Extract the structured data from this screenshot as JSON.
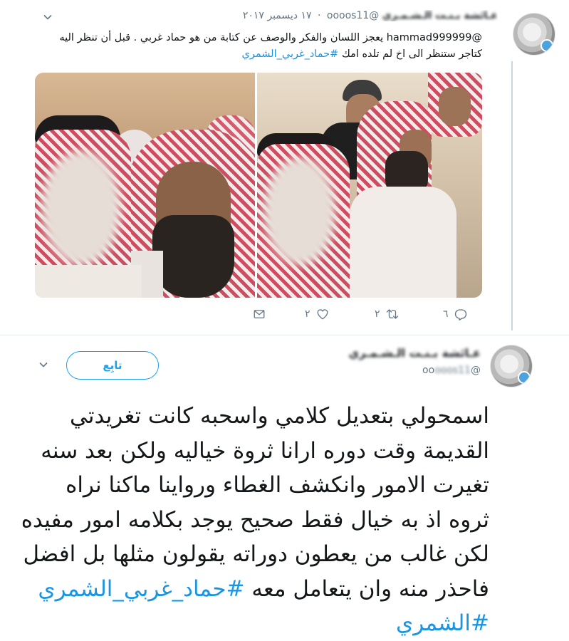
{
  "reply_tweet": {
    "author_name": "عـائشة بـنـت الـشـمـري",
    "author_handle": "@oooos11",
    "separator": "·",
    "timestamp": "١٧ ديسمبر ٢٠١٧",
    "text_mention": "@hammad999999",
    "text_body": " يعجز اللسان والفكر والوصف عن كتابة من هو حماد غربي . قبل أن تنظر اليه كتاجر ستنظر الى اخ لم تلده امك ",
    "hashtag": "#حماد_غربي_الشمري",
    "actions": {
      "reply_count": "٦",
      "retweet_count": "٢",
      "like_count": "٢"
    }
  },
  "main_tweet": {
    "author_name": "عـائشة بـنـت الـشـمـري",
    "author_handle_prefix": "@oo",
    "author_handle_blur": "ooos11",
    "follow_label": "تابِع",
    "text_body": "اسمحولي بتعديل كلامي  واسحبه كانت تغريدتي القديمة وقت دوره ارانا ثروة خياليه ولكن بعد سنه تغيرت الامور وانكشف الغطاء ورواينا ماكنا نراه ثروه اذ به خيال فقط صحيح يوجد بكلامه امور مفيده لكن غالب من يعطون دوراته يقولون مثلها بل افضل فاحذر منه وان يتعامل معه ",
    "hashtag1": "#حماد_غربي_الشمري",
    "hashtag2": "#الشمري"
  },
  "icons": {
    "reply": "reply-icon",
    "retweet": "retweet-icon",
    "like": "heart-icon",
    "dm": "envelope-icon",
    "menu": "chevron-down-icon"
  },
  "colors": {
    "link": "#1b95e0",
    "follow": "#1da1f2",
    "muted": "#657786"
  }
}
